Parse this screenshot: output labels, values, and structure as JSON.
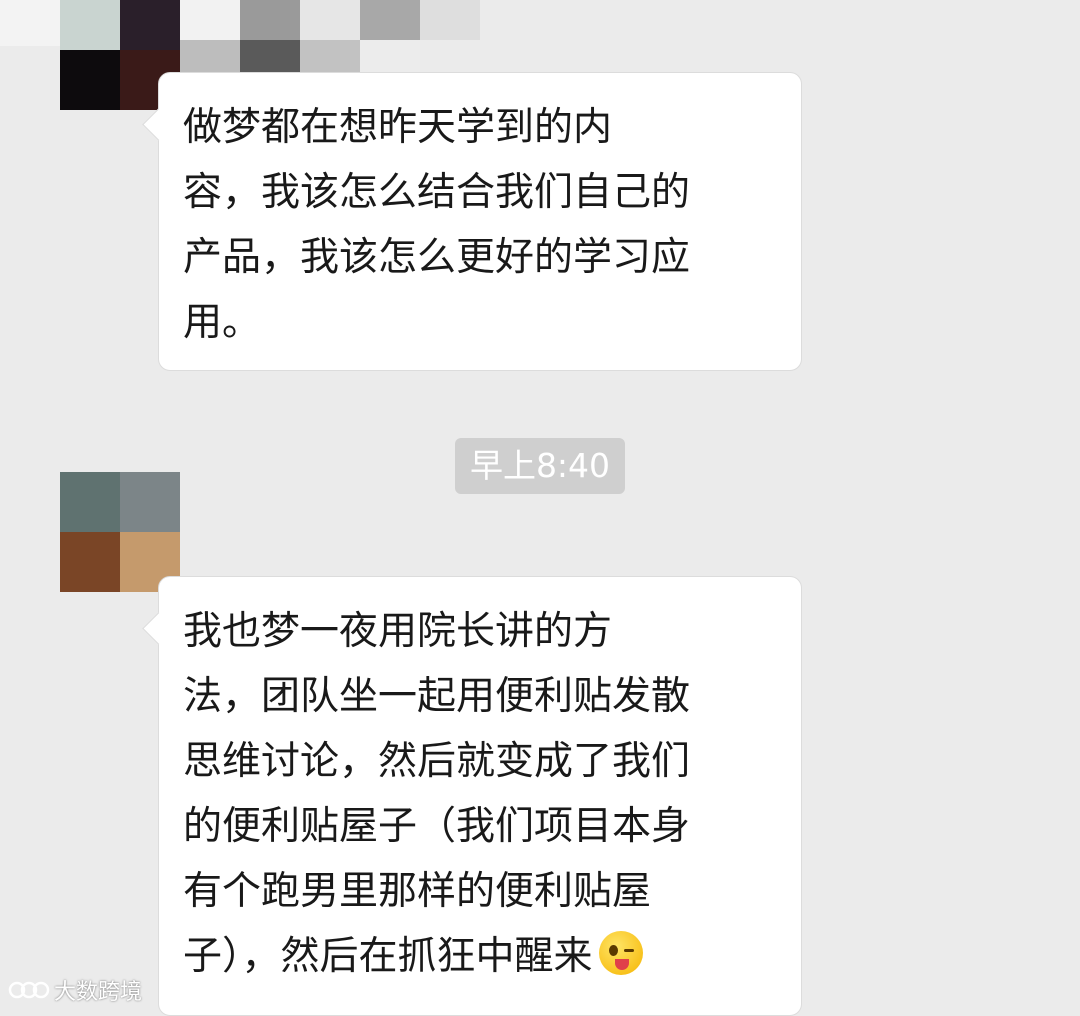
{
  "messages": [
    {
      "lines": [
        "做梦都在想昨天学到的内",
        "容，我该怎么结合我们自己的",
        "产品，我该怎么更好的学习应",
        "用。"
      ]
    },
    {
      "lines": [
        "我也梦一夜用院长讲的方",
        "法，团队坐一起用便利贴发散",
        "思维讨论，然后就变成了我们",
        "的便利贴屋子（我们项目本身",
        "有个跑男里那样的便利贴屋",
        "子），然后在抓狂中醒来"
      ],
      "emoji": "winking-tongue-face-icon"
    }
  ],
  "timestamp": "早上8:40",
  "watermark": {
    "text": "大数跨境"
  },
  "colors": {
    "chat_background": "#ebebeb",
    "bubble_background": "#ffffff",
    "bubble_border": "#dcdcdc",
    "timestamp_pill": "#cfcfcf"
  }
}
